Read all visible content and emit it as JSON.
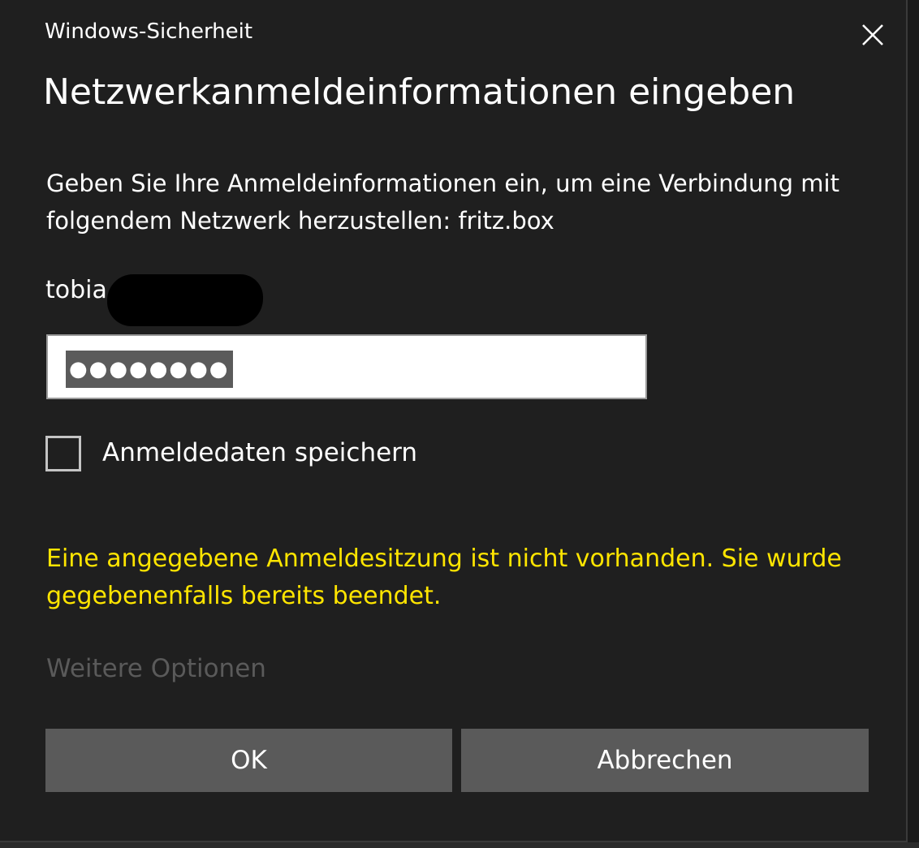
{
  "window": {
    "title": "Windows-Sicherheit",
    "close_icon": "close-icon"
  },
  "heading": "Netzwerkanmeldeinformationen eingeben",
  "description": "Geben Sie Ihre Anmeldeinformationen ein, um eine Verbindung mit folgendem Netzwerk herzustellen: fritz.box",
  "username": {
    "visible_text": "tobia",
    "redacted": true
  },
  "password": {
    "value": "●●●●●●●●",
    "selected": true
  },
  "remember_checkbox": {
    "label": "Anmeldedaten speichern",
    "checked": false
  },
  "error_message": "Eine angegebene Anmeldesitzung ist nicht vorhanden. Sie wurde gegebenenfalls bereits beendet.",
  "more_options": "Weitere Optionen",
  "buttons": {
    "ok": "OK",
    "cancel": "Abbrechen"
  },
  "colors": {
    "background": "#1f1f1f",
    "error_text": "#ffe500",
    "button_bg": "#5a5a5a",
    "disabled_link": "#5a5a5a"
  }
}
